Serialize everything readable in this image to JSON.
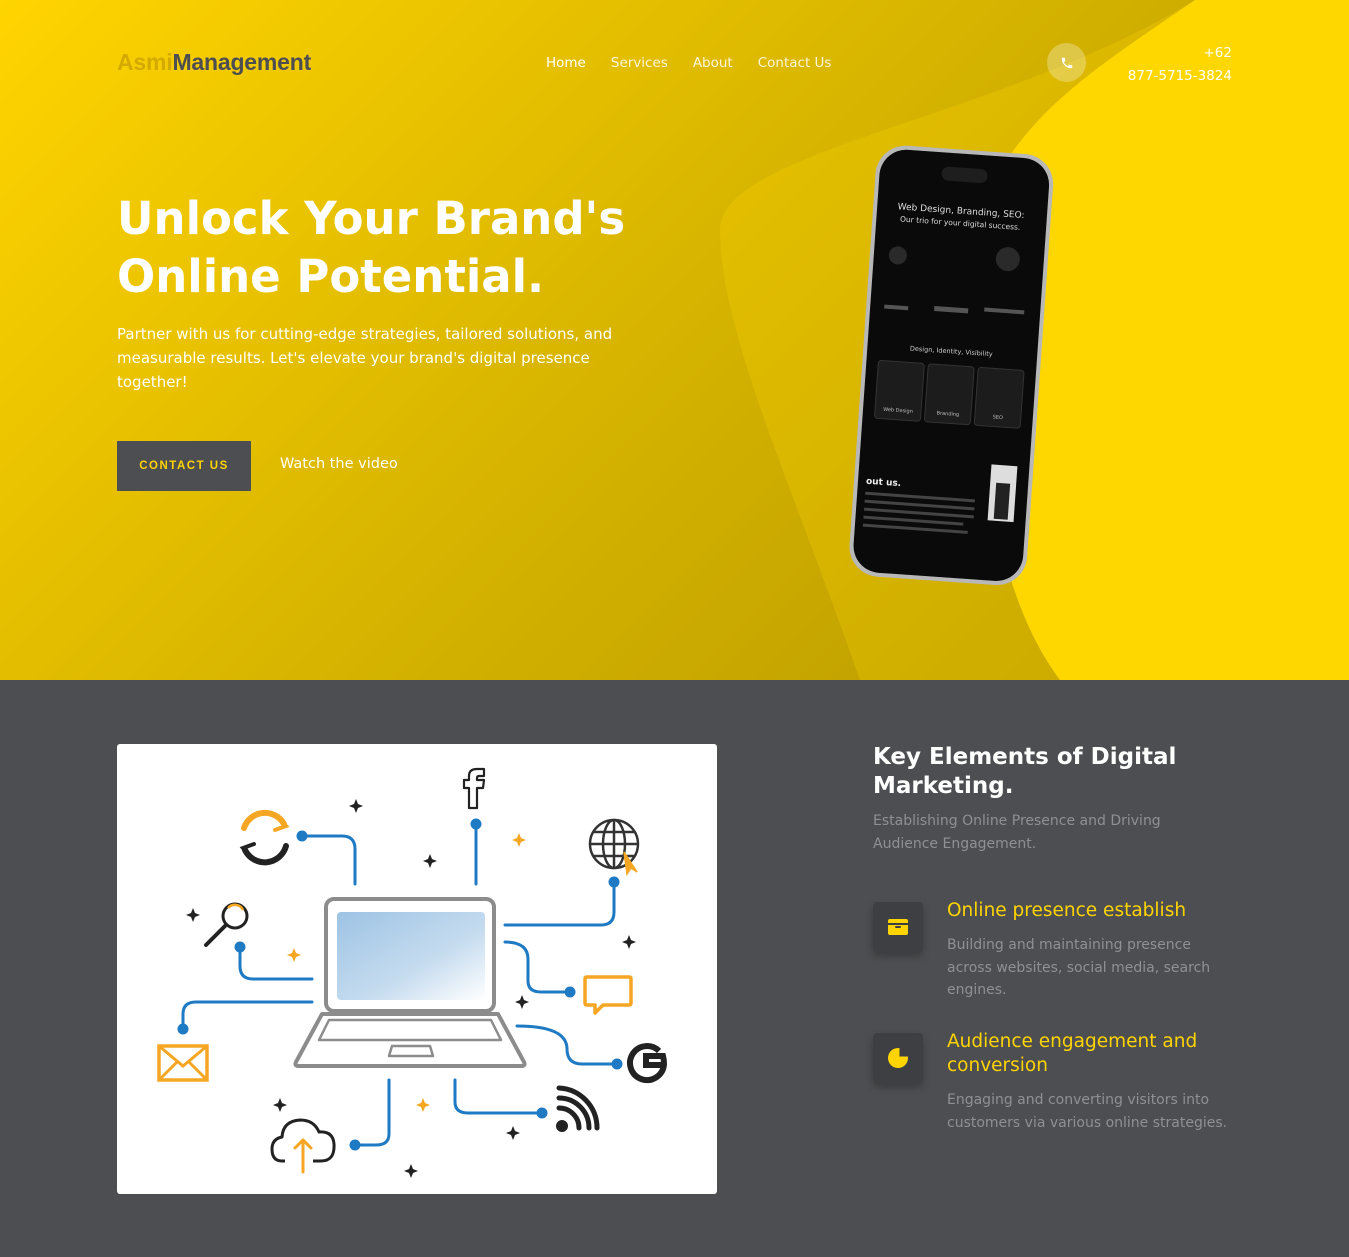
{
  "brand": {
    "part1": "Asmi",
    "part2": "Management"
  },
  "nav": {
    "home": "Home",
    "services": "Services",
    "about": "About",
    "contact": "Contact Us"
  },
  "header": {
    "phone_line1": "+62",
    "phone_line2": "877-5715-3824"
  },
  "hero": {
    "title": "Unlock Your Brand's Online Potential.",
    "subtitle": "Partner with us for cutting-edge strategies, tailored solutions, and measurable results. Let's elevate your brand's digital presence together!",
    "cta_label": "CONTACT US",
    "video_link": "Watch the video"
  },
  "phone_screen": {
    "headline": "Web Design, Branding, SEO:",
    "headline2": "Our trio for your digital success.",
    "section": "Design, Identity, Visibility",
    "cards": [
      "Web Design",
      "Branding",
      "SEO"
    ],
    "about": "out us."
  },
  "section": {
    "title": "Key Elements of Digital Marketing.",
    "subtitle": "Establishing Online Presence and Driving Audience Engagement."
  },
  "features": [
    {
      "title": "Online presence establish",
      "text": "Building and maintaining presence across websites, social media, search engines.",
      "icon": "wallet-icon"
    },
    {
      "title": "Audience engagement and conversion",
      "text": "Engaging and converting visitors into customers via various online strategies.",
      "icon": "pie-chart-icon"
    }
  ],
  "colors": {
    "accent": "#ffd400",
    "dark": "#4d4e51",
    "muted": "#8f9093"
  }
}
